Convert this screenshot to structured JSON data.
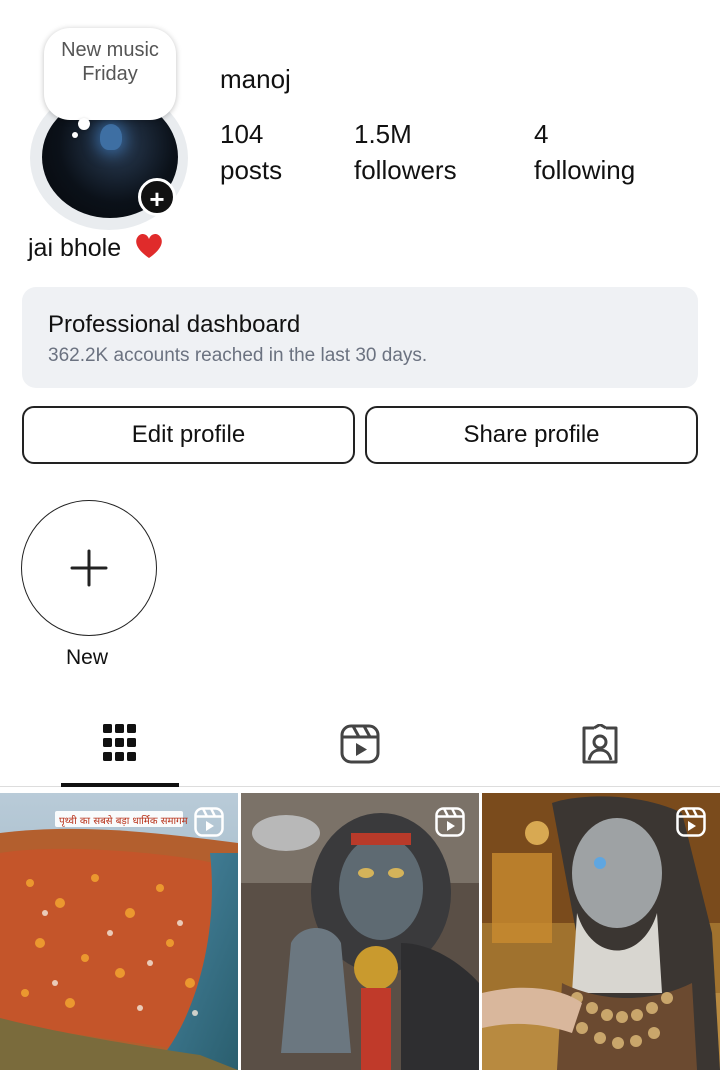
{
  "profile": {
    "note": "New music Friday",
    "username": "manoj",
    "bio": "jai bhole",
    "stats": [
      {
        "value": "104",
        "label": "posts"
      },
      {
        "value": "1.5M",
        "label": "followers"
      },
      {
        "value": "4",
        "label": "following"
      }
    ]
  },
  "dashboard": {
    "title": "Professional dashboard",
    "subtitle": "362.2K accounts reached in the last 30 days."
  },
  "buttons": {
    "edit": "Edit profile",
    "share": "Share profile"
  },
  "highlights": {
    "new_label": "New"
  },
  "tabs": [
    {
      "icon": "grid-icon",
      "active": true
    },
    {
      "icon": "reels-icon",
      "active": false
    },
    {
      "icon": "tagged-icon",
      "active": false
    }
  ],
  "posts": [
    {
      "type": "reel",
      "banner": "पृथ्वी का सबसे बड़ा धार्मिक समागम"
    },
    {
      "type": "reel"
    },
    {
      "type": "reel"
    }
  ]
}
